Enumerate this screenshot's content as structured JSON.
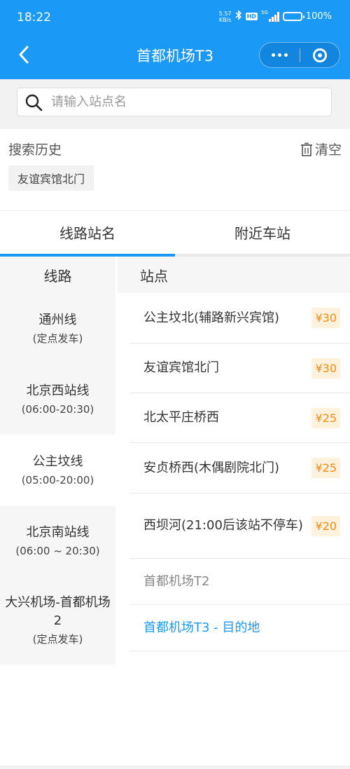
{
  "status_bar": {
    "time": "18:22",
    "net_speed": "5.57",
    "net_unit": "KB/s",
    "hd": "HD",
    "network": "5G",
    "battery": "100%"
  },
  "nav": {
    "title": "首都机场T3",
    "back_icon": "chevron-left-icon",
    "more_icon": "more-dots-icon",
    "close_icon": "target-circle-icon"
  },
  "search": {
    "placeholder": "请输入站点名",
    "value": ""
  },
  "history": {
    "label": "搜索历史",
    "clear_label": "清空",
    "items": [
      "友谊宾馆北门"
    ]
  },
  "tabs": [
    {
      "label": "线路站名",
      "active": true
    },
    {
      "label": "附近车站",
      "active": false
    }
  ],
  "columns": {
    "routes": "线路",
    "stations": "站点"
  },
  "routes": [
    {
      "name": "通州线",
      "sub": "(定点发车)"
    },
    {
      "name": "北京西站线",
      "sub": "(06:00-20:30)"
    },
    {
      "name": "公主坟线",
      "sub": "(05:00-20:00)"
    },
    {
      "name": "北京南站线",
      "sub": "(06:00 ~ 20:30)"
    },
    {
      "name": "大兴机场-首都机场2",
      "sub": "(定点发车)"
    }
  ],
  "stations": [
    {
      "name": "公主坟北(辅路新兴宾馆)",
      "price": "¥30"
    },
    {
      "name": "友谊宾馆北门",
      "price": "¥30"
    },
    {
      "name": "北太平庄桥西",
      "price": "¥25"
    },
    {
      "name": "安贞桥西(木偶剧院北门)",
      "price": "¥25"
    },
    {
      "name": "西坝河(21:00后该站不停车)",
      "price": "¥20"
    },
    {
      "name": "首都机场T2",
      "price": ""
    },
    {
      "name": "首都机场T3 - 目的地",
      "price": ""
    }
  ],
  "colors": {
    "brand": "#1a9af6",
    "price_text": "#f08c1a",
    "price_bg": "#fff2dd"
  }
}
